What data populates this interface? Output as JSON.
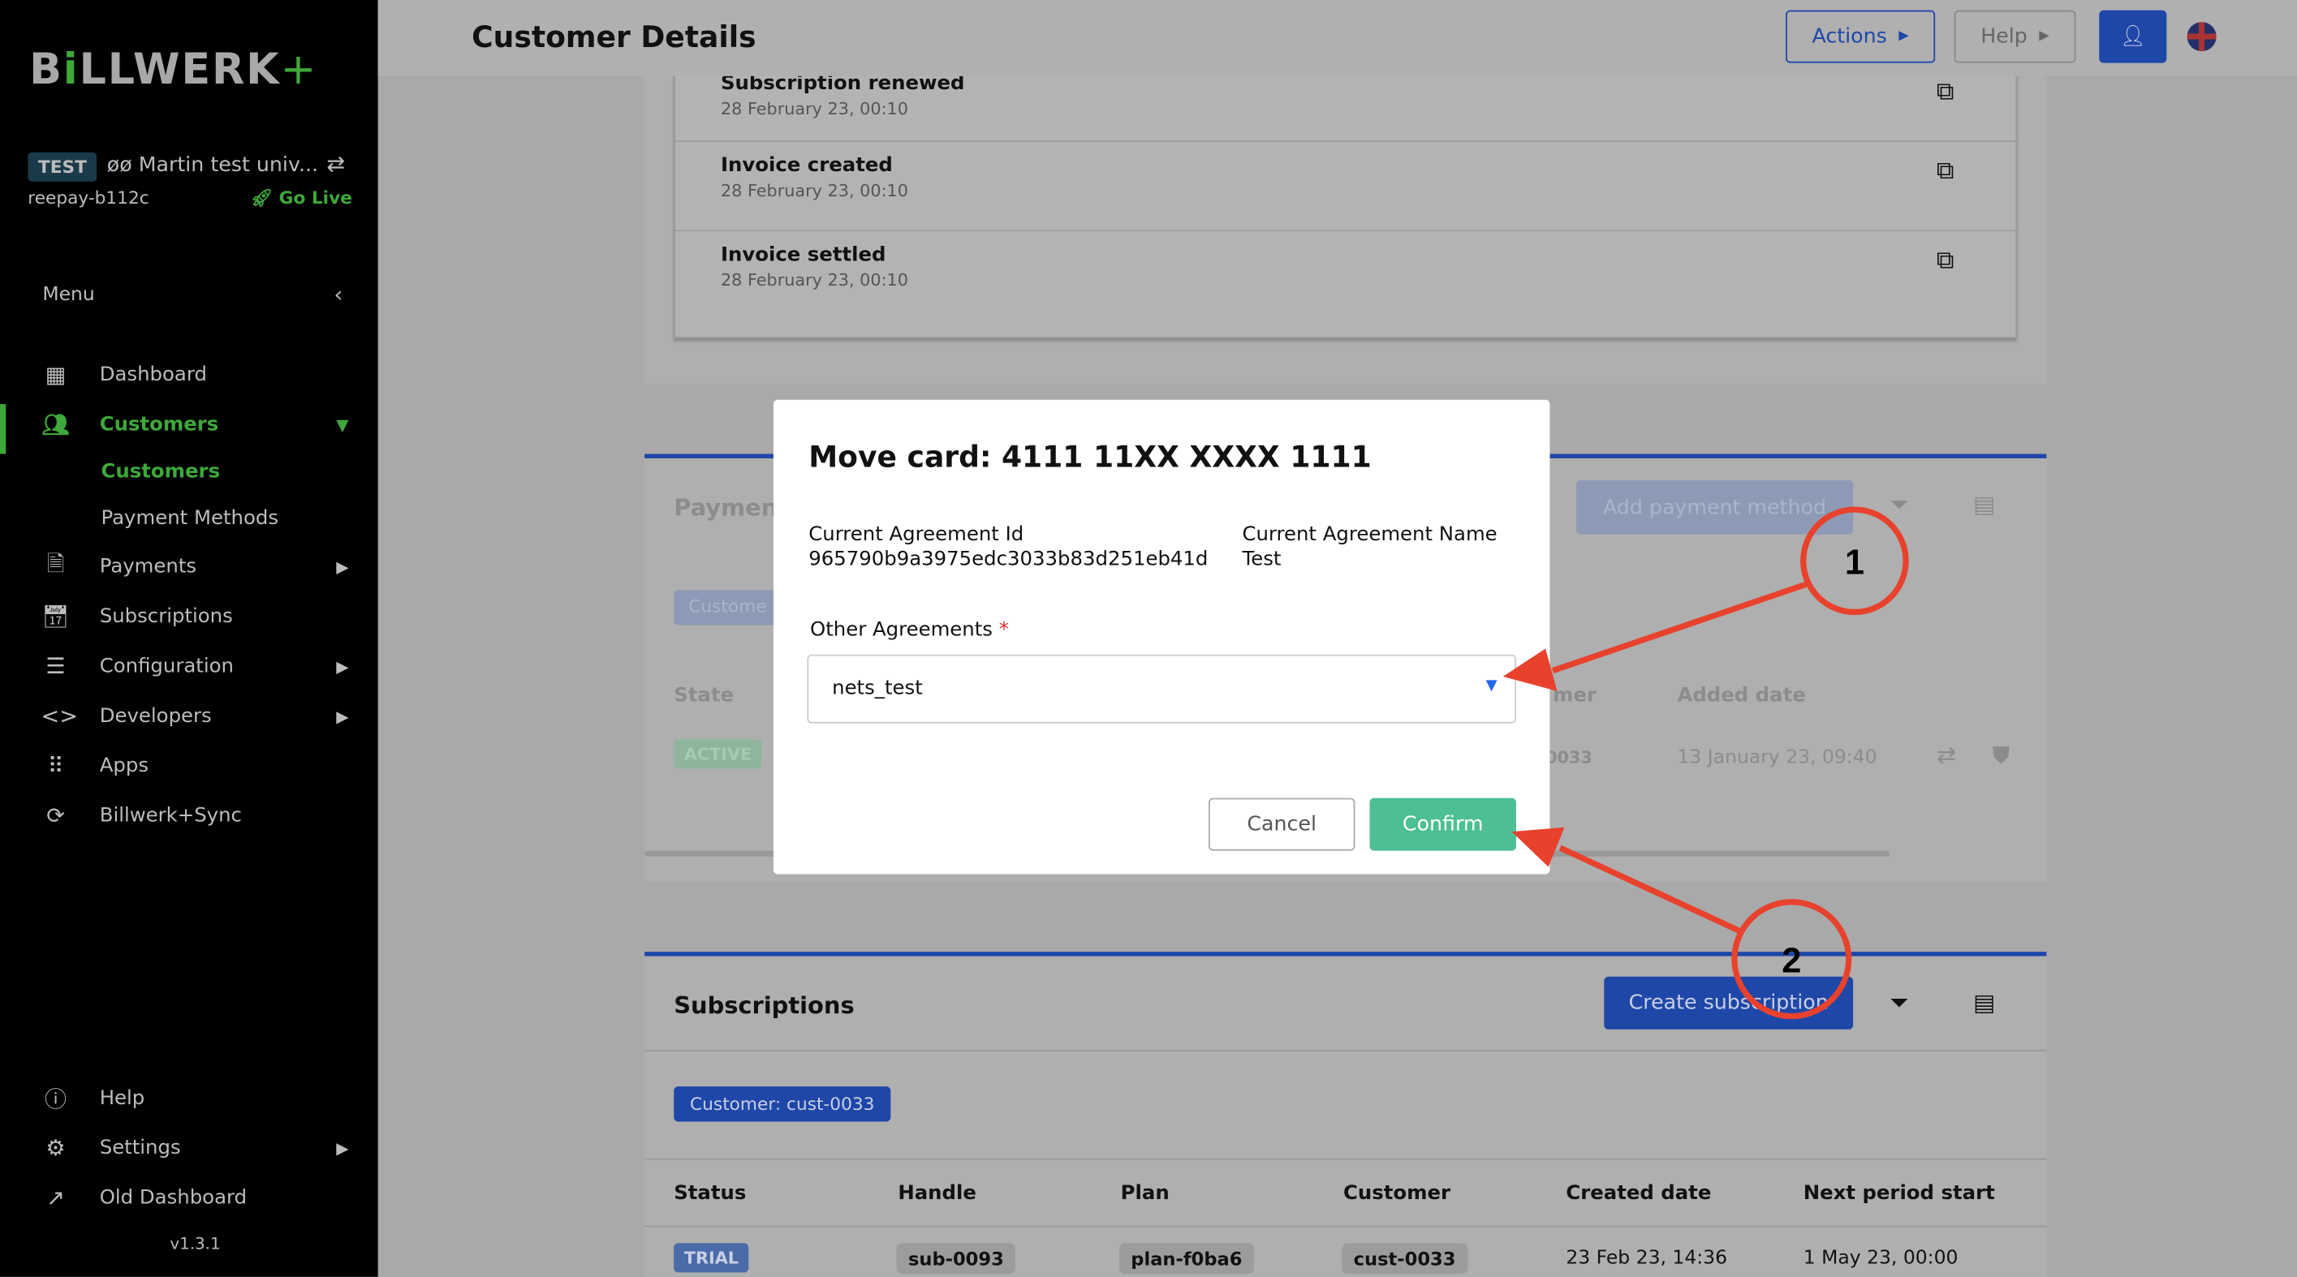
{
  "sidebar": {
    "logo": "BiLLWERK+",
    "env_badge": "TEST",
    "org_name": "øø Martin test univ...",
    "account": "reepay-b112c",
    "go_live": "Go Live",
    "menu_label": "Menu",
    "items": [
      {
        "label": "Dashboard",
        "icon": "grid-icon"
      },
      {
        "label": "Customers",
        "icon": "users-icon",
        "active": true
      },
      {
        "label": "Payments",
        "icon": "document-icon"
      },
      {
        "label": "Subscriptions",
        "icon": "calendar-clock-icon"
      },
      {
        "label": "Configuration",
        "icon": "sliders-icon"
      },
      {
        "label": "Developers",
        "icon": "code-icon"
      },
      {
        "label": "Apps",
        "icon": "apps-icon"
      },
      {
        "label": "Billwerk+Sync",
        "icon": "sync-icon"
      }
    ],
    "sub_items": [
      "Customers",
      "Payment Methods"
    ],
    "bottom_items": [
      {
        "label": "Help",
        "icon": "help-icon"
      },
      {
        "label": "Settings",
        "icon": "gear-icon"
      },
      {
        "label": "Old Dashboard",
        "icon": "external-link-icon"
      }
    ],
    "version": "v1.3.1"
  },
  "header": {
    "title": "Customer Details",
    "actions_label": "Actions",
    "help_label": "Help"
  },
  "events": [
    {
      "title": "Subscription renewed",
      "date": "28 February 23, 00:10"
    },
    {
      "title": "Invoice created",
      "date": "28 February 23, 00:10"
    },
    {
      "title": "Invoice settled",
      "date": "28 February 23, 00:10"
    }
  ],
  "payment_methods": {
    "title": "Paymen",
    "add_label": "Add payment method",
    "filter_chip": "Custome",
    "col_state": "State",
    "col_customer": "mer",
    "col_added": "Added date",
    "row": {
      "state": "ACTIVE",
      "customer": "0033",
      "added": "13 January 23, 09:40"
    }
  },
  "modal": {
    "title": "Move card: 4111 11XX XXXX 1111",
    "agreement_id_label": "Current Agreement Id",
    "agreement_id": "965790b9a3975edc3033b83d251eb41d",
    "agreement_name_label": "Current Agreement Name",
    "agreement_name": "Test",
    "other_label": "Other Agreements",
    "required_mark": "*",
    "selected": "nets_test",
    "cancel_label": "Cancel",
    "confirm_label": "Confirm"
  },
  "subscriptions": {
    "title": "Subscriptions",
    "create_label": "Create subscription",
    "filter_chip": "Customer: cust-0033",
    "columns": [
      "Status",
      "Handle",
      "Plan",
      "Customer",
      "Created date",
      "Next period start"
    ],
    "rows": [
      {
        "status": "TRIAL",
        "handle": "sub-0093",
        "plan": "plan-f0ba6",
        "customer": "cust-0033",
        "created": "23 Feb 23, 14:36",
        "next": "1 May 23, 00:00"
      }
    ]
  },
  "annotations": {
    "first": "1",
    "second": "2",
    "color": "#e8412c"
  }
}
